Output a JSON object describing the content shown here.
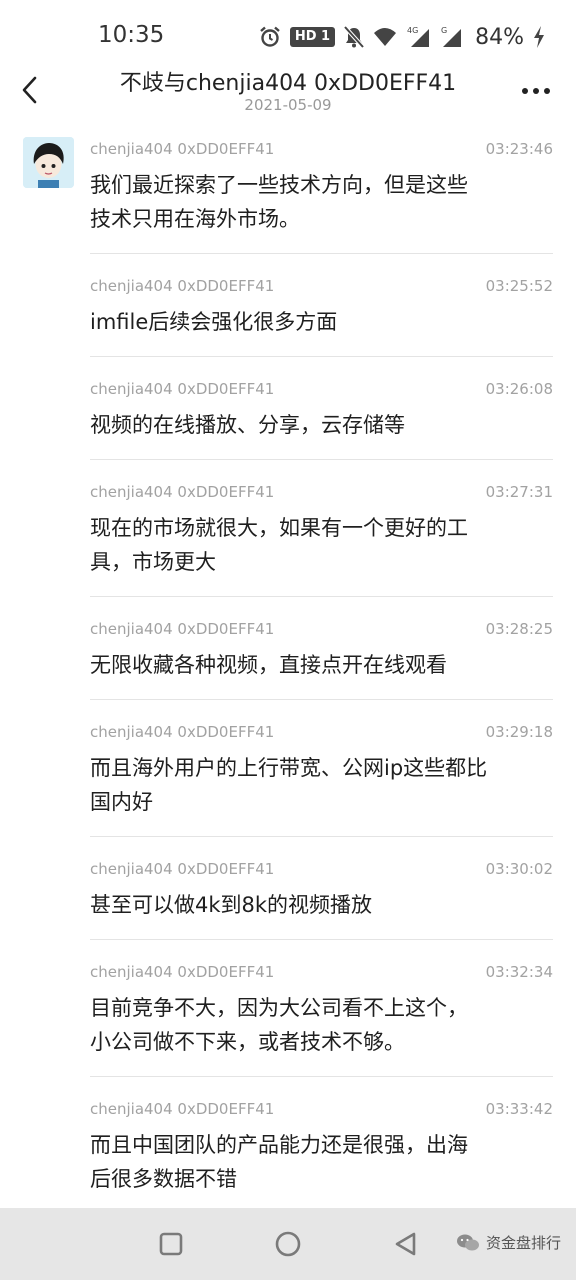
{
  "status_bar": {
    "time": "10:35",
    "hd_badge": "HD 1",
    "battery_percent": "84%",
    "icons": [
      "alarm-icon",
      "hd-badge",
      "mute-icon",
      "wifi-icon",
      "signal-4g-icon",
      "signal-g-icon",
      "battery-charging-icon"
    ]
  },
  "header": {
    "title": "不歧与chenjia404 0xDD0EFF41",
    "date": "2021-05-09",
    "icons": [
      "back-arrow-icon",
      "more-dots-icon"
    ]
  },
  "messages": [
    {
      "sender": "chenjia404 0xDD0EFF41",
      "time": "03:23:46",
      "lines": [
        "我们最近探索了一些技术方向，但是这些",
        "技术只用在海外市场。"
      ]
    },
    {
      "sender": "chenjia404 0xDD0EFF41",
      "time": "03:25:52",
      "lines": [
        "imfile后续会强化很多方面"
      ]
    },
    {
      "sender": "chenjia404 0xDD0EFF41",
      "time": "03:26:08",
      "lines": [
        "视频的在线播放、分享，云存储等"
      ]
    },
    {
      "sender": "chenjia404 0xDD0EFF41",
      "time": "03:27:31",
      "lines": [
        "现在的市场就很大，如果有一个更好的工",
        "具，市场更大"
      ]
    },
    {
      "sender": "chenjia404 0xDD0EFF41",
      "time": "03:28:25",
      "lines": [
        "无限收藏各种视频，直接点开在线观看"
      ]
    },
    {
      "sender": "chenjia404 0xDD0EFF41",
      "time": "03:29:18",
      "lines": [
        "而且海外用户的上行带宽、公网ip这些都比",
        "国内好"
      ]
    },
    {
      "sender": "chenjia404 0xDD0EFF41",
      "time": "03:30:02",
      "lines": [
        "甚至可以做4k到8k的视频播放"
      ]
    },
    {
      "sender": "chenjia404 0xDD0EFF41",
      "time": "03:32:34",
      "lines": [
        "目前竞争不大，因为大公司看不上这个，",
        "小公司做不下来，或者技术不够。"
      ]
    },
    {
      "sender": "chenjia404 0xDD0EFF41",
      "time": "03:33:42",
      "lines": [
        "而且中国团队的产品能力还是很强，出海",
        "后很多数据不错"
      ]
    }
  ],
  "navbar": {
    "icons": [
      "recents-square-icon",
      "home-circle-icon",
      "back-triangle-icon"
    ],
    "watermark_text": "资金盘排行"
  },
  "colors": {
    "navbar_bg": "#e6e6e6",
    "meta_text": "#a2a2a2",
    "divider": "#e4e4e4"
  }
}
